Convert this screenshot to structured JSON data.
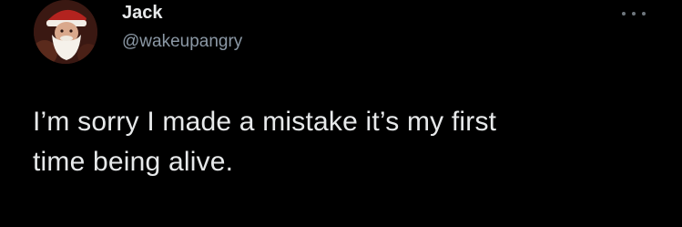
{
  "tweet": {
    "author": {
      "display_name": "Jack",
      "handle": "@wakeupangry",
      "avatar_icon": "santa-avatar"
    },
    "more_icon": "ellipsis-horizontal-icon",
    "text_line_1": "I’m sorry I made a mistake it’s my first",
    "text_line_2": "time being alive."
  },
  "colors": {
    "background": "#000000",
    "primary_text": "#e7e9ea",
    "secondary_text": "#8b98a5"
  }
}
